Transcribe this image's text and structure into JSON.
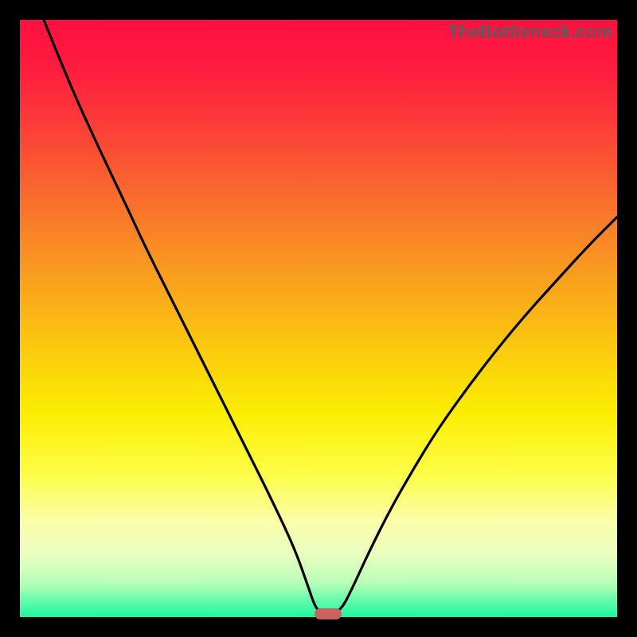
{
  "watermark": "TheBottleneck.com",
  "colors": {
    "gradient_stops": [
      {
        "offset": 0.0,
        "color": "#fe1040"
      },
      {
        "offset": 0.08,
        "color": "#fe1c3f"
      },
      {
        "offset": 0.18,
        "color": "#fb3f37"
      },
      {
        "offset": 0.3,
        "color": "#f96d2d"
      },
      {
        "offset": 0.42,
        "color": "#f99b1f"
      },
      {
        "offset": 0.55,
        "color": "#fbca0e"
      },
      {
        "offset": 0.66,
        "color": "#fbee02"
      },
      {
        "offset": 0.76,
        "color": "#fdfd48"
      },
      {
        "offset": 0.84,
        "color": "#fbfdab"
      },
      {
        "offset": 0.9,
        "color": "#e6fec0"
      },
      {
        "offset": 0.945,
        "color": "#b3feb7"
      },
      {
        "offset": 0.97,
        "color": "#6afcab"
      },
      {
        "offset": 1.0,
        "color": "#1df79f"
      }
    ],
    "curve": "#000000",
    "marker": "#c76360",
    "frame": "#000000"
  },
  "chart_data": {
    "type": "line",
    "title": "",
    "xlabel": "",
    "ylabel": "",
    "xlim": [
      0,
      100
    ],
    "ylim": [
      0,
      100
    ],
    "series": [
      {
        "name": "bottleneck-curve",
        "points": [
          {
            "x": 4.0,
            "y": 100.0
          },
          {
            "x": 8.0,
            "y": 90.0
          },
          {
            "x": 13.0,
            "y": 79.0
          },
          {
            "x": 18.0,
            "y": 68.5
          },
          {
            "x": 21.0,
            "y": 62.0
          },
          {
            "x": 26.0,
            "y": 52.0
          },
          {
            "x": 30.0,
            "y": 44.0
          },
          {
            "x": 34.0,
            "y": 36.0
          },
          {
            "x": 38.0,
            "y": 28.0
          },
          {
            "x": 42.0,
            "y": 20.0
          },
          {
            "x": 46.0,
            "y": 11.5
          },
          {
            "x": 48.3,
            "y": 5.0
          },
          {
            "x": 49.5,
            "y": 1.5
          },
          {
            "x": 50.7,
            "y": 0.6
          },
          {
            "x": 52.6,
            "y": 0.6
          },
          {
            "x": 54.0,
            "y": 1.6
          },
          {
            "x": 55.5,
            "y": 4.5
          },
          {
            "x": 58.5,
            "y": 11.0
          },
          {
            "x": 62.0,
            "y": 18.0
          },
          {
            "x": 66.0,
            "y": 25.0
          },
          {
            "x": 70.0,
            "y": 31.5
          },
          {
            "x": 75.0,
            "y": 38.5
          },
          {
            "x": 80.0,
            "y": 45.0
          },
          {
            "x": 85.0,
            "y": 51.0
          },
          {
            "x": 90.0,
            "y": 56.5
          },
          {
            "x": 95.0,
            "y": 62.0
          },
          {
            "x": 100.0,
            "y": 67.0
          }
        ]
      }
    ],
    "marker": {
      "x": 51.6,
      "y": 0.6
    }
  }
}
